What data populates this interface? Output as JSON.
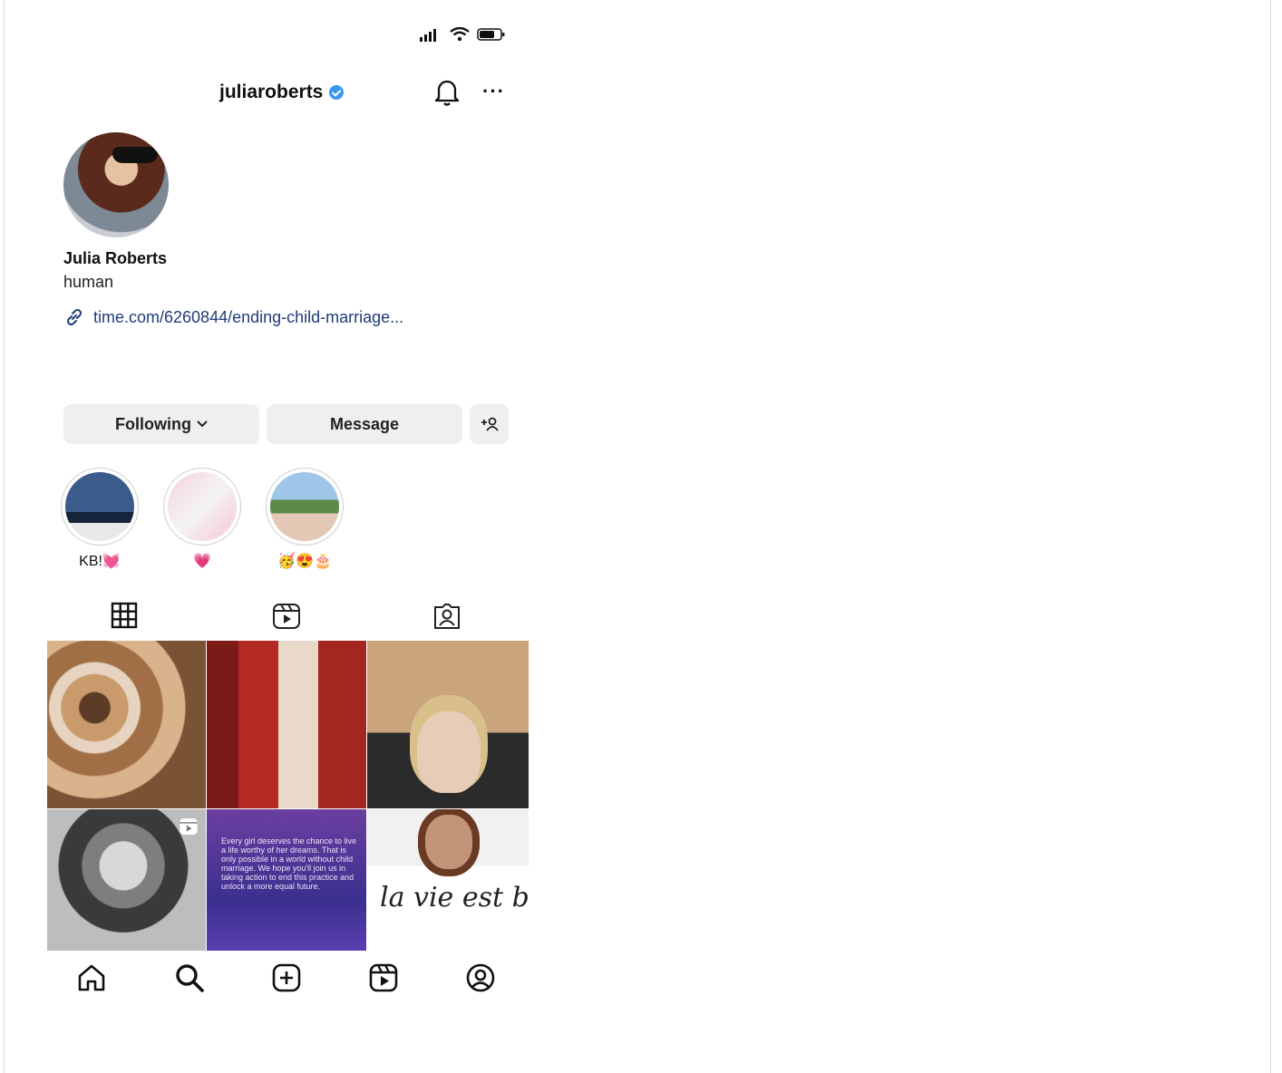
{
  "status_bar": {
    "signal_icon": "signal-bars-icon",
    "wifi_icon": "wifi-icon",
    "battery_icon": "battery-icon"
  },
  "header": {
    "username": "juliaroberts",
    "verified_icon": "verified-badge-icon",
    "bell_icon": "bell-icon",
    "more_label": "···"
  },
  "profile": {
    "full_name": "Julia Roberts",
    "bio": "human",
    "link_text": "time.com/6260844/ending-child-marriage...",
    "link_icon": "link-icon"
  },
  "actions": {
    "following_label": "Following",
    "message_label": "Message",
    "add_person_icon": "add-person-icon"
  },
  "highlights": [
    {
      "label": "KB!💓"
    },
    {
      "label": "💗"
    },
    {
      "label": "🥳😍🎂"
    }
  ],
  "tabs": [
    {
      "name": "grid",
      "icon": "grid-icon",
      "selected": true
    },
    {
      "name": "reels",
      "icon": "reels-icon"
    },
    {
      "name": "tagged",
      "icon": "tagged-icon"
    }
  ],
  "posts": {
    "quote_text": "Every girl deserves the chance to live a life worthy of her dreams. That is only possible in a world without child marriage. We hope you'll join us in taking action to end this practice and unlock a more equal future.",
    "script_text": "la vie est belle"
  },
  "bottom_nav": [
    "home-icon",
    "search-icon",
    "new-post-icon",
    "reels-icon",
    "profile-icon"
  ],
  "colors": {
    "verified": "#3897f0",
    "link": "#1f3c7a",
    "button_bg": "#efefef"
  }
}
